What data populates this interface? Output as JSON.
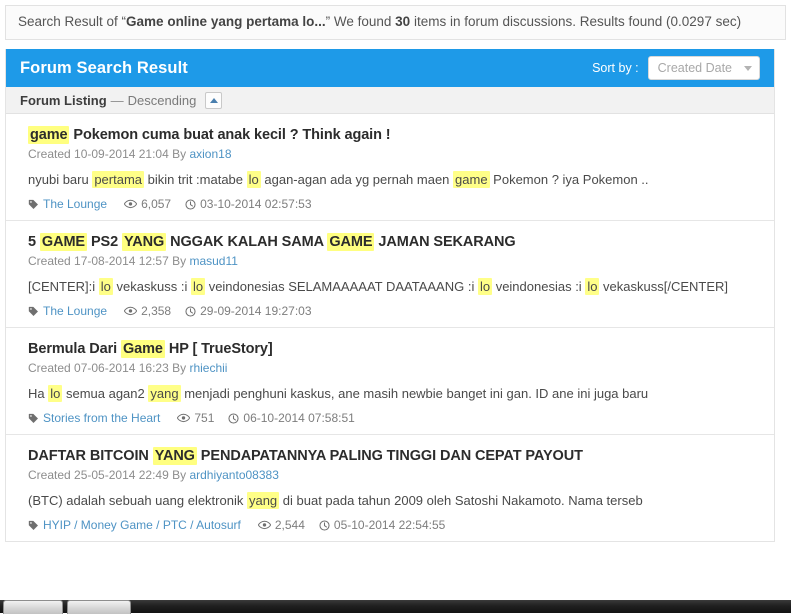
{
  "notice": {
    "prefix": "Search Result of “",
    "query": "Game online yang pertama lo...",
    "mid": "” We found ",
    "count": "30",
    "suffix": " items in forum discussions. Results found (0.0297 sec)"
  },
  "panel": {
    "title": "Forum Search Result",
    "sort_label": "Sort by :",
    "sort_value": "Created Date",
    "sort_options": [
      "Created Date"
    ],
    "caret_down_icon": "chevron-down-icon"
  },
  "subheader": {
    "listing_label": "Forum Listing",
    "dash": "—",
    "direction": "Descending",
    "collapse_icon": "caret-up-icon"
  },
  "icons": {
    "tag": "tag-icon",
    "views": "eye-icon",
    "time": "clock-icon"
  },
  "results": [
    {
      "title_parts": [
        {
          "t": "game",
          "hl": true
        },
        {
          "t": " Pokemon cuma buat anak kecil ? Think again !",
          "hl": false
        }
      ],
      "created_prefix": "Created ",
      "created_date": "10-09-2014 21:04",
      "by_label": " By ",
      "author": "axion18",
      "snippet_parts": [
        {
          "t": "nyubi baru ",
          "hl": false
        },
        {
          "t": "pertama",
          "hl": true
        },
        {
          "t": " bikin trit :matabe ",
          "hl": false
        },
        {
          "t": "lo",
          "hl": true
        },
        {
          "t": " agan-agan ada yg pernah maen ",
          "hl": false
        },
        {
          "t": "game",
          "hl": true
        },
        {
          "t": " Pokemon ? iya Pokemon ..",
          "hl": false
        }
      ],
      "category": "The Lounge",
      "views": "6,057",
      "time": "03-10-2014 02:57:53"
    },
    {
      "title_parts": [
        {
          "t": "5 ",
          "hl": false
        },
        {
          "t": "GAME",
          "hl": true
        },
        {
          "t": " PS2 ",
          "hl": false
        },
        {
          "t": "YANG",
          "hl": true
        },
        {
          "t": " NGGAK KALAH SAMA ",
          "hl": false
        },
        {
          "t": "GAME",
          "hl": true
        },
        {
          "t": " JAMAN SEKARANG",
          "hl": false
        }
      ],
      "created_prefix": "Created ",
      "created_date": "17-08-2014 12:57",
      "by_label": " By ",
      "author": "masud11",
      "snippet_parts": [
        {
          "t": "[CENTER]:i ",
          "hl": false
        },
        {
          "t": "lo",
          "hl": true
        },
        {
          "t": " vekaskuss :i ",
          "hl": false
        },
        {
          "t": "lo",
          "hl": true
        },
        {
          "t": " veindonesias SELAMAAAAAT DAATAAANG :i ",
          "hl": false
        },
        {
          "t": "lo",
          "hl": true
        },
        {
          "t": " veindonesias :i ",
          "hl": false
        },
        {
          "t": "lo",
          "hl": true
        },
        {
          "t": " vekaskuss[/CENTER]",
          "hl": false
        }
      ],
      "category": "The Lounge",
      "views": "2,358",
      "time": "29-09-2014 19:27:03"
    },
    {
      "title_parts": [
        {
          "t": "Bermula Dari ",
          "hl": false
        },
        {
          "t": "Game",
          "hl": true
        },
        {
          "t": " HP [ TrueStory]",
          "hl": false
        }
      ],
      "created_prefix": "Created ",
      "created_date": "07-06-2014 16:23",
      "by_label": " By ",
      "author": "rhiechii",
      "snippet_parts": [
        {
          "t": "Ha ",
          "hl": false
        },
        {
          "t": "lo",
          "hl": true
        },
        {
          "t": " semua agan2 ",
          "hl": false
        },
        {
          "t": "yang",
          "hl": true
        },
        {
          "t": " menjadi penghuni kaskus, ane masih newbie banget ini gan. ID ane ini juga baru",
          "hl": false
        }
      ],
      "category": "Stories from the Heart",
      "views": "751",
      "time": "06-10-2014 07:58:51"
    },
    {
      "title_parts": [
        {
          "t": "DAFTAR BITCOIN ",
          "hl": false
        },
        {
          "t": "YANG",
          "hl": true
        },
        {
          "t": " PENDAPATANNYA PALING TINGGI DAN CEPAT PAYOUT",
          "hl": false
        }
      ],
      "created_prefix": "Created ",
      "created_date": "25-05-2014 22:49",
      "by_label": " By ",
      "author": "ardhiyanto08383",
      "snippet_parts": [
        {
          "t": "(BTC) adalah sebuah uang elektronik ",
          "hl": false
        },
        {
          "t": "yang",
          "hl": true
        },
        {
          "t": " di buat pada tahun 2009 oleh Satoshi Nakamoto. Nama terseb",
          "hl": false
        }
      ],
      "category": "HYIP / Money Game / PTC / Autosurf",
      "views": "2,544",
      "time": "05-10-2014 22:54:55"
    }
  ],
  "taskbar": {
    "buttons": [
      "",
      ""
    ]
  },
  "colors": {
    "accent_blue": "#1e9ae8",
    "link_blue": "#4e93c4",
    "highlight_yellow": "#ffff88"
  }
}
